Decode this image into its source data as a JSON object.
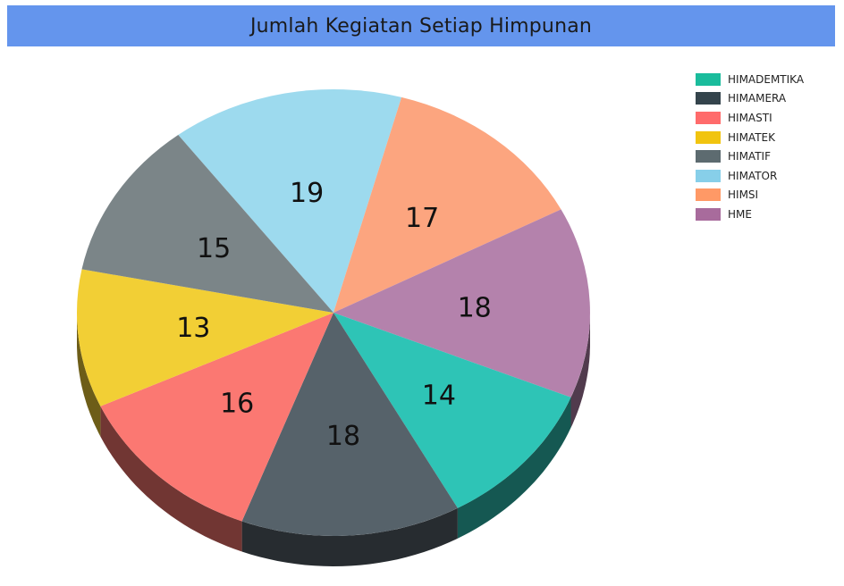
{
  "header": {
    "title": "Jumlah Kegiatan Setiap Himpunan"
  },
  "chart_data": {
    "type": "pie",
    "title": "Jumlah Kegiatan Setiap Himpunan",
    "style": "3d",
    "legend_position": "top-right",
    "categories": [
      "HIMADEMTIKA",
      "HIMAMERA",
      "HIMASTI",
      "HIMATEK",
      "HIMATIF",
      "HIMATOR",
      "HIMSI",
      "HME"
    ],
    "values": [
      14,
      18,
      16,
      13,
      15,
      19,
      17,
      18
    ],
    "labels": [
      "14",
      "18",
      "16",
      "13",
      "15",
      "19",
      "17",
      "18"
    ],
    "colors": [
      "#2ec4b6",
      "#56626a",
      "#fb7872",
      "#f2cf35",
      "#7b8588",
      "#9ddaee",
      "#fca57f",
      "#b482ac"
    ],
    "legend_colors": [
      "#1abc9c",
      "#34444c",
      "#ff6b6b",
      "#f1c40f",
      "#5d6b70",
      "#87cfe9",
      "#ff9966",
      "#a86b9c"
    ],
    "draw_order": [
      "HIMATOR",
      "HIMSI",
      "HME",
      "HIMADEMTIKA",
      "HIMAMERA",
      "HIMASTI",
      "HIMATEK",
      "HIMATIF"
    ]
  }
}
